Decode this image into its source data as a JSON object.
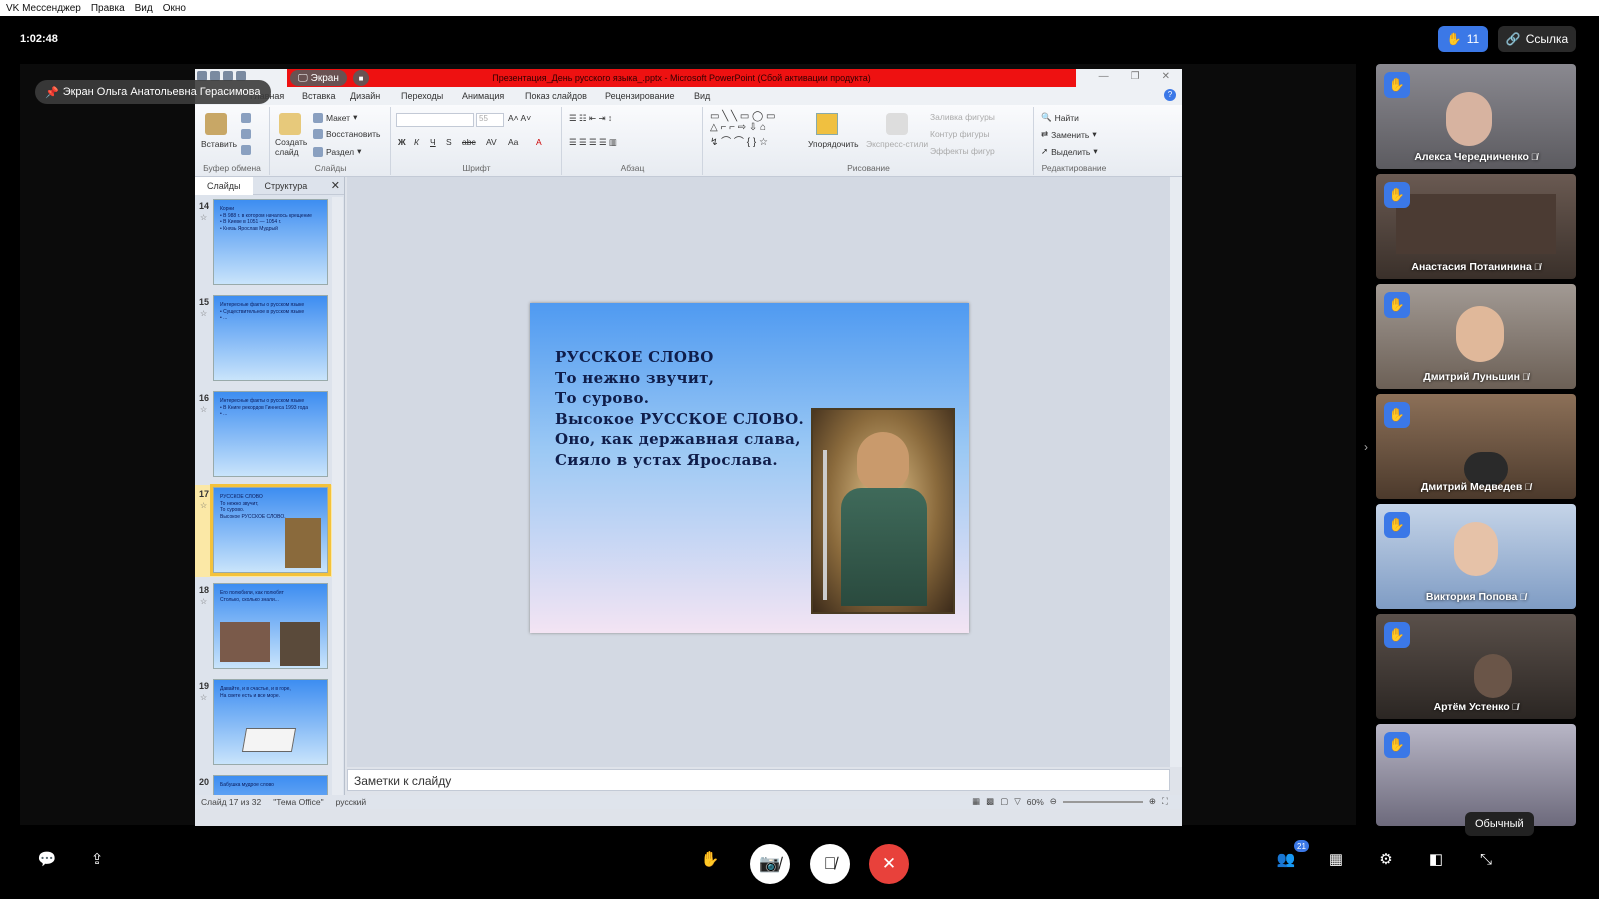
{
  "menubar": {
    "items": [
      "VK Мессенджер",
      "Правка",
      "Вид",
      "Окно"
    ]
  },
  "call": {
    "timer": "1:02:48",
    "hands_count": "11",
    "link_label": "Ссылка",
    "screen_badge": "Экран Ольга Анатольевна Герасимова",
    "screen_button": "Экран"
  },
  "ppt": {
    "title": "Презентация_День русского языка_.pptx - Microsoft PowerPoint (Сбой активации продукта)",
    "tabs": [
      "Главная",
      "Вставка",
      "Дизайн",
      "Переходы",
      "Анимация",
      "Показ слайдов",
      "Рецензирование",
      "Вид"
    ],
    "groups": {
      "clipboard": "Буфер обмена",
      "slides": "Слайды",
      "font": "Шрифт",
      "paragraph": "Абзац",
      "drawing": "Рисование",
      "editing": "Редактирование"
    },
    "buttons": {
      "paste": "Вставить",
      "new_slide": "Создать слайд",
      "layout": "Макет",
      "reset": "Восстановить",
      "section": "Раздел",
      "font_size": "55",
      "arrange": "Упорядочить",
      "quick_styles": "Экспресс-стили",
      "fill": "Заливка фигуры",
      "outline": "Контур фигуры",
      "effects": "Эффекты фигур",
      "find": "Найти",
      "replace": "Заменить",
      "select": "Выделить"
    },
    "panel_tabs": [
      "Слайды",
      "Структура"
    ],
    "thumbnails": [
      {
        "num": "14",
        "text": "Корни\n• В 988 г. в котором началось крещение\n• В Киеве в 1051 — 1054 г.\n• Князь Ярослав Мудрый"
      },
      {
        "num": "15",
        "text": "Интересные факты о русском языке\n• Существительное в русском языке\n• ..."
      },
      {
        "num": "16",
        "text": "Интересные факты о русском языке\n• В Книге рекордов Гиннеса 1993 года\n• ..."
      },
      {
        "num": "17",
        "text": "РУССКОЕ СЛОВО\nТо нежно звучит,\nТо сурово.\nВысокое РУССКОЕ СЛОВО."
      },
      {
        "num": "18",
        "text": "Его полюбили, как полюбят\nСтолько, сколько знали..."
      },
      {
        "num": "19",
        "text": "Давайте, и в счастье, и в горе,\nНа свете есть и все море."
      },
      {
        "num": "20",
        "text": "Бабушка мудрое слово"
      }
    ],
    "slide_text": "РУССКОЕ СЛОВО\nТо нежно звучит,\nТо сурово.\nВысокое РУССКОЕ СЛОВО.\nОно, как державная слава,\nСияло в устах Ярослава.",
    "notes_placeholder": "Заметки к слайду",
    "status": {
      "slide": "Слайд 17 из 32",
      "theme": "\"Тема Office\"",
      "lang": "русский",
      "zoom": "60%"
    }
  },
  "participants": [
    {
      "name": "Алекса Чередниченко",
      "bg": "#6b6a6e"
    },
    {
      "name": "Анастасия Потанинина",
      "bg": "#5a4b42"
    },
    {
      "name": "Дмитрий Луньшин",
      "bg": "#7a6f66"
    },
    {
      "name": "Дмитрий Медведев",
      "bg": "#6c5544"
    },
    {
      "name": "Виктория Попова",
      "bg": "#8ca6c9"
    },
    {
      "name": "Артём Устенко",
      "bg": "#3f3a36"
    },
    {
      "name": "",
      "bg": "#8f8e9f"
    }
  ],
  "tooltip": "Обычный",
  "participants_count": "21"
}
